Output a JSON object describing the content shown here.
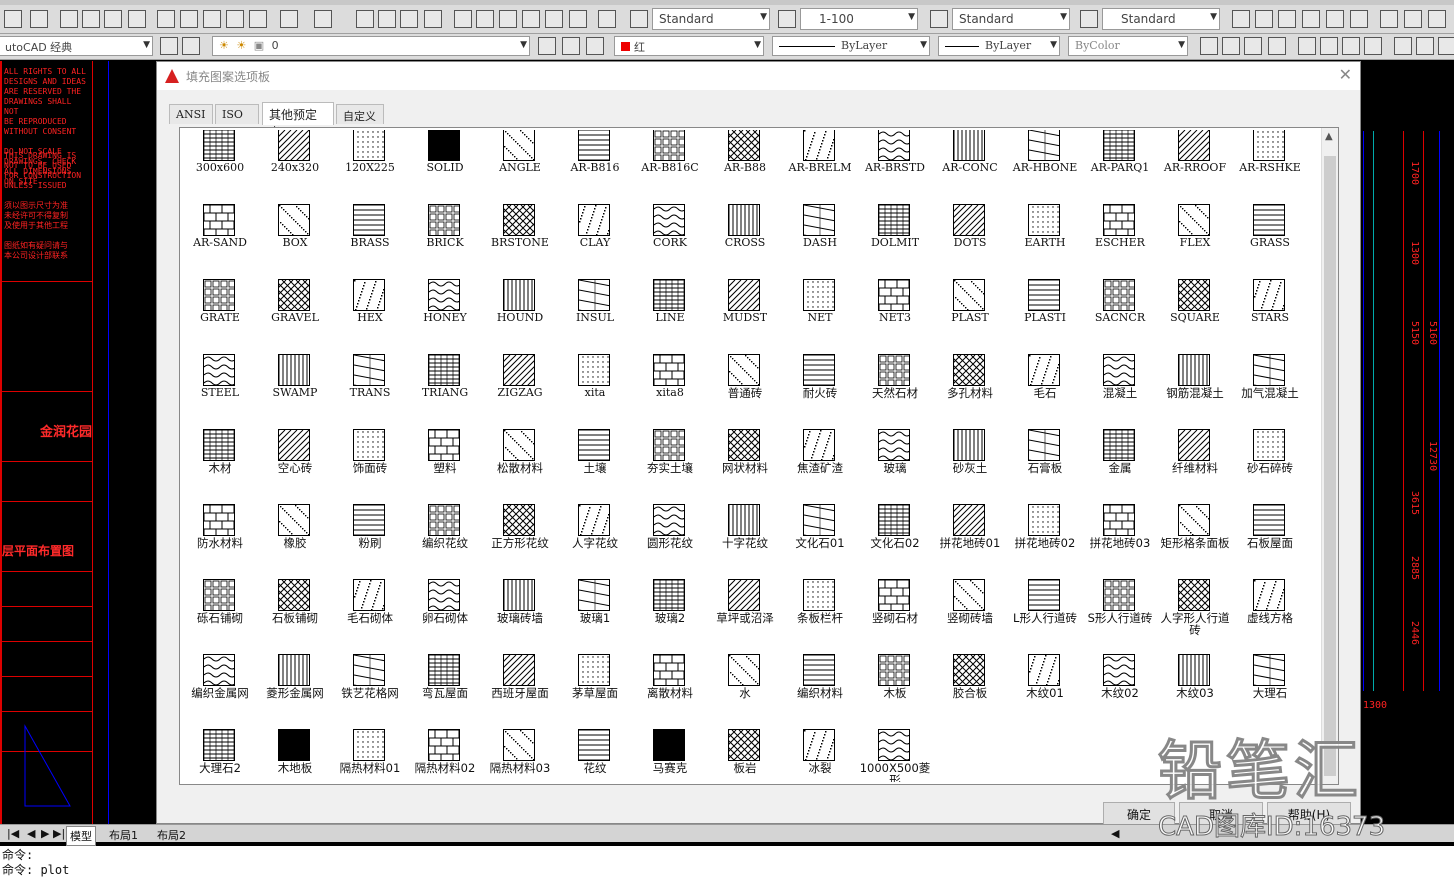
{
  "toolbar": {
    "text_style": "Standard",
    "dim_scale": "1-100",
    "table_style": "Standard",
    "multileader_style": "Standard",
    "workspace": "utoCAD 经典",
    "layer_value": "0",
    "color": "红",
    "linetype": "ByLayer",
    "lineweight": "ByLayer",
    "plotstyle": "ByColor"
  },
  "dialog": {
    "title": "填充图案选项板",
    "close": "✕",
    "tabs": [
      {
        "label": "ANSI"
      },
      {
        "label": "ISO"
      },
      {
        "label": "其他预定义"
      },
      {
        "label": "自定义"
      }
    ],
    "buttons": {
      "ok": "确定",
      "cancel": "取消",
      "help": "帮助(H)"
    }
  },
  "patterns": [
    [
      "300x600",
      "240x320",
      "120X225",
      "SOLID",
      "ANGLE",
      "AR-B816",
      "AR-B816C",
      "AR-B88",
      "AR-BRELM",
      "AR-BRSTD",
      "AR-CONC",
      "AR-HBONE",
      "AR-PARQ1",
      "AR-RROOF",
      "AR-RSHKE"
    ],
    [
      "AR-SAND",
      "BOX",
      "BRASS",
      "BRICK",
      "BRSTONE",
      "CLAY",
      "CORK",
      "CROSS",
      "DASH",
      "DOLMIT",
      "DOTS",
      "EARTH",
      "ESCHER",
      "FLEX",
      "GRASS"
    ],
    [
      "GRATE",
      "GRAVEL",
      "HEX",
      "HONEY",
      "HOUND",
      "INSUL",
      "LINE",
      "MUDST",
      "NET",
      "NET3",
      "PLAST",
      "PLASTI",
      "SACNCR",
      "SQUARE",
      "STARS"
    ],
    [
      "STEEL",
      "SWAMP",
      "TRANS",
      "TRIANG",
      "ZIGZAG",
      "xita",
      "xita8",
      "普通砖",
      "耐火砖",
      "天然石材",
      "多孔材料",
      "毛石",
      "混凝土",
      "钢筋混凝土",
      "加气混凝土"
    ],
    [
      "木材",
      "空心砖",
      "饰面砖",
      "塑料",
      "松散材料",
      "土壤",
      "夯实土壤",
      "网状材料",
      "焦渣矿渣",
      "玻璃",
      "砂灰土",
      "石膏板",
      "金属",
      "纤维材料",
      "砂石碎砖"
    ],
    [
      "防水材料",
      "橡胶",
      "粉刷",
      "编织花纹",
      "正方形花纹",
      "人字花纹",
      "圆形花纹",
      "十字花纹",
      "文化石01",
      "文化石02",
      "拼花地砖01",
      "拼花地砖02",
      "拼花地砖03",
      "矩形格条面板",
      "石板屋面"
    ],
    [
      "砾石铺砌",
      "石板铺砌",
      "毛石砌体",
      "卵石砌体",
      "玻璃砖墙",
      "玻璃1",
      "玻璃2",
      "草坪或沼泽",
      "条板栏杆",
      "竖砌石材",
      "竖砌砖墙",
      "L形人行道砖",
      "S形人行道砖",
      "人字形人行道砖",
      "虚线方格"
    ],
    [
      "编织金属网",
      "菱形金属网",
      "铁艺花格网",
      "弯瓦屋面",
      "西班牙屋面",
      "茅草屋面",
      "离散材料",
      "水",
      "编织材料",
      "木板",
      "胶合板",
      "木纹01",
      "木纹02",
      "木纹03",
      "大理石"
    ],
    [
      "大理石2",
      "木地板",
      "隔热材料01",
      "隔热材料02",
      "隔热材料03",
      "花纹",
      "马赛克",
      "板岩",
      "冰裂",
      "1000X500菱形"
    ]
  ],
  "layout_tabs": [
    {
      "label": "模型"
    },
    {
      "label": "布局1"
    },
    {
      "label": "布局2"
    }
  ],
  "command_lines": [
    "命令:",
    "命令:  plot"
  ],
  "drawing": {
    "left_title": "金润花园",
    "left_title2": "层平面布置图",
    "right_dims": [
      "5150",
      "5160",
      "1300",
      "1700",
      "3615",
      "12730",
      "2885",
      "2446",
      "1300"
    ]
  },
  "watermark": {
    "logo": "铅笔汇",
    "id": "CAD图库ID:16373"
  }
}
